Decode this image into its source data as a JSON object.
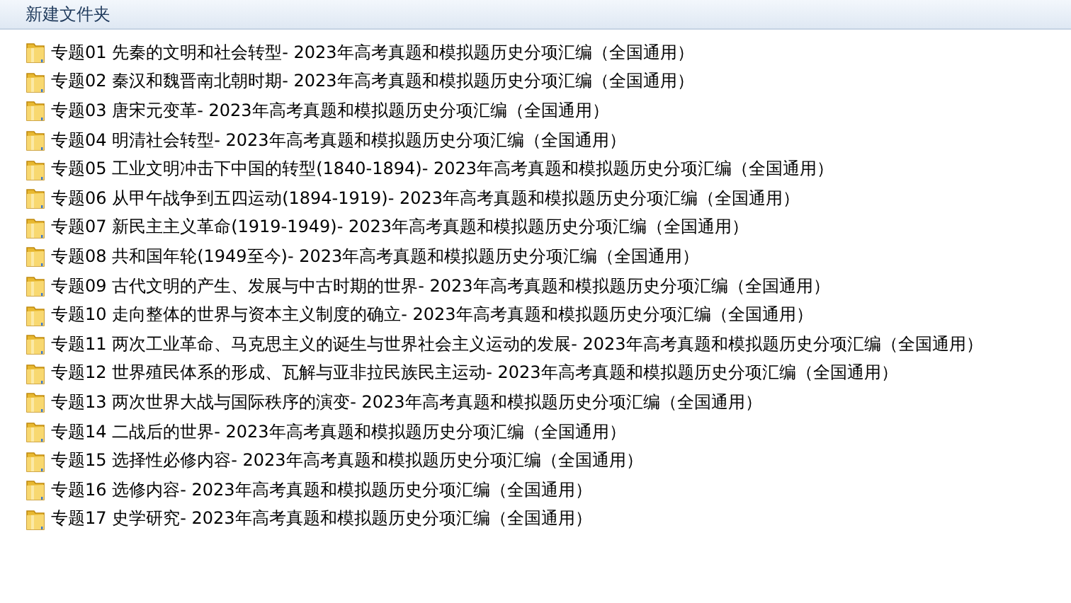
{
  "toolbar": {
    "new_folder": "新建文件夹"
  },
  "files": [
    {
      "name": "专题01 先秦的文明和社会转型- 2023年高考真题和模拟题历史分项汇编（全国通用）"
    },
    {
      "name": "专题02 秦汉和魏晋南北朝时期- 2023年高考真题和模拟题历史分项汇编（全国通用）"
    },
    {
      "name": "专题03 唐宋元变革- 2023年高考真题和模拟题历史分项汇编（全国通用）"
    },
    {
      "name": "专题04 明清社会转型- 2023年高考真题和模拟题历史分项汇编（全国通用）"
    },
    {
      "name": "专题05 工业文明冲击下中国的转型(1840-1894)- 2023年高考真题和模拟题历史分项汇编（全国通用）"
    },
    {
      "name": "专题06 从甲午战争到五四运动(1894-1919)- 2023年高考真题和模拟题历史分项汇编（全国通用）"
    },
    {
      "name": "专题07 新民主主义革命(1919-1949)- 2023年高考真题和模拟题历史分项汇编（全国通用）"
    },
    {
      "name": "专题08 共和国年轮(1949至今)- 2023年高考真题和模拟题历史分项汇编（全国通用）"
    },
    {
      "name": "专题09 古代文明的产生、发展与中古时期的世界- 2023年高考真题和模拟题历史分项汇编（全国通用）"
    },
    {
      "name": "专题10 走向整体的世界与资本主义制度的确立- 2023年高考真题和模拟题历史分项汇编（全国通用）"
    },
    {
      "name": "专题11 两次工业革命、马克思主义的诞生与世界社会主义运动的发展- 2023年高考真题和模拟题历史分项汇编（全国通用）"
    },
    {
      "name": "专题12 世界殖民体系的形成、瓦解与亚非拉民族民主运动- 2023年高考真题和模拟题历史分项汇编（全国通用）"
    },
    {
      "name": "专题13 两次世界大战与国际秩序的演变- 2023年高考真题和模拟题历史分项汇编（全国通用）"
    },
    {
      "name": "专题14 二战后的世界- 2023年高考真题和模拟题历史分项汇编（全国通用）"
    },
    {
      "name": "专题15 选择性必修内容- 2023年高考真题和模拟题历史分项汇编（全国通用）"
    },
    {
      "name": "专题16 选修内容- 2023年高考真题和模拟题历史分项汇编（全国通用）"
    },
    {
      "name": "专题17 史学研究- 2023年高考真题和模拟题历史分项汇编（全国通用）"
    }
  ]
}
